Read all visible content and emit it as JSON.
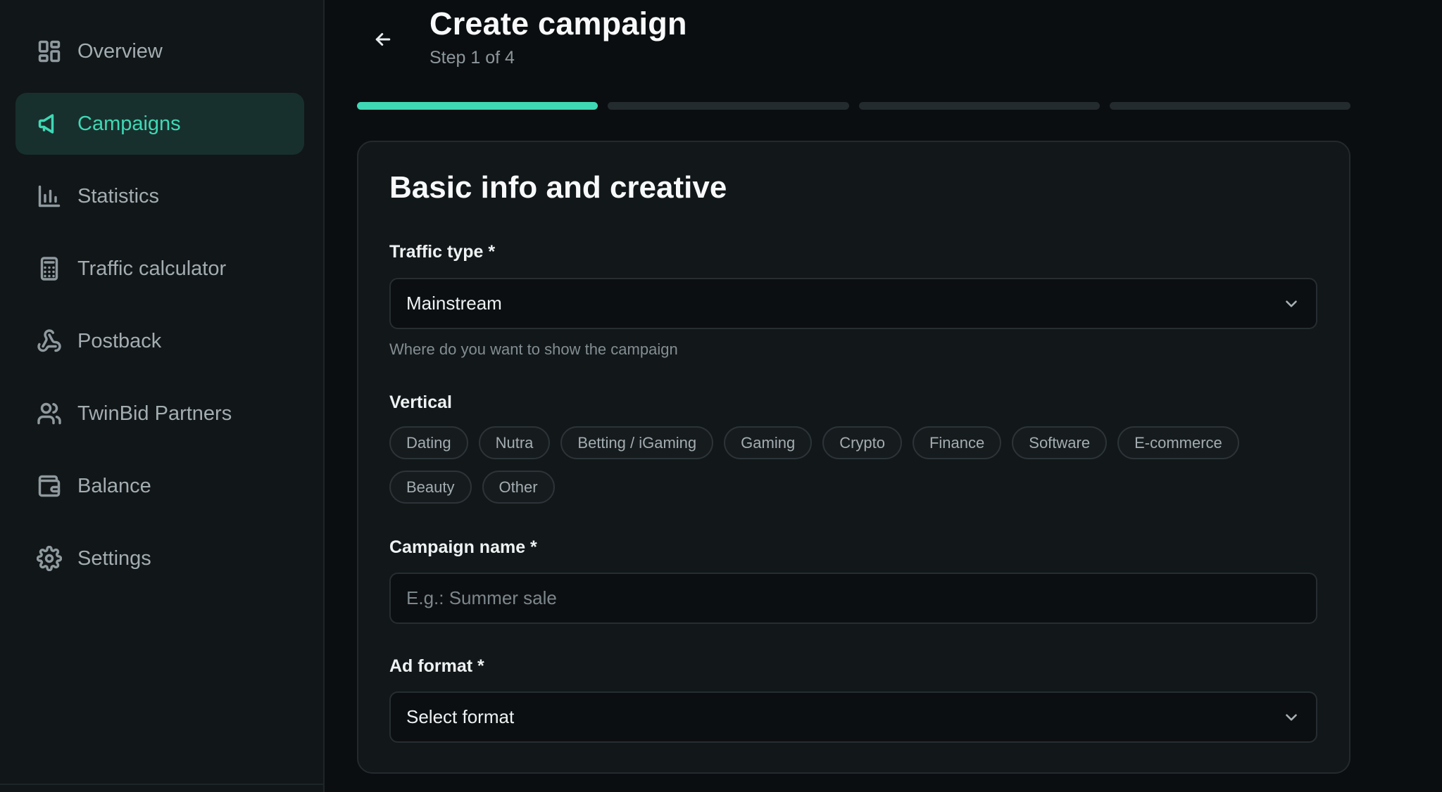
{
  "sidebar": {
    "items": [
      {
        "label": "Overview",
        "icon": "dashboard-icon",
        "active": false
      },
      {
        "label": "Campaigns",
        "icon": "megaphone-icon",
        "active": true
      },
      {
        "label": "Statistics",
        "icon": "bar-chart-icon",
        "active": false
      },
      {
        "label": "Traffic calculator",
        "icon": "calculator-icon",
        "active": false
      },
      {
        "label": "Postback",
        "icon": "webhook-icon",
        "active": false
      },
      {
        "label": "TwinBid Partners",
        "icon": "users-icon",
        "active": false
      },
      {
        "label": "Balance",
        "icon": "wallet-icon",
        "active": false
      },
      {
        "label": "Settings",
        "icon": "gear-icon",
        "active": false
      }
    ]
  },
  "header": {
    "title": "Create campaign",
    "step": "Step 1 of 4",
    "back_icon": "arrow-left-icon"
  },
  "progress": {
    "current_step": 1,
    "total_steps": 4
  },
  "form": {
    "section_title": "Basic info and creative",
    "traffic_type": {
      "label": "Traffic type *",
      "value": "Mainstream",
      "help": "Where do you want to show the campaign"
    },
    "vertical": {
      "label": "Vertical",
      "options": [
        "Dating",
        "Nutra",
        "Betting / iGaming",
        "Gaming",
        "Crypto",
        "Finance",
        "Software",
        "E-commerce",
        "Beauty",
        "Other"
      ]
    },
    "campaign_name": {
      "label": "Campaign name *",
      "placeholder": "E.g.: Summer sale",
      "value": ""
    },
    "ad_format": {
      "label": "Ad format *",
      "value": "Select format"
    }
  },
  "colors": {
    "accent": "#3ed8b5",
    "background": "#0b0e10",
    "sidebar": "#111618",
    "card": "#121719",
    "active_nav_bg": "#18302d"
  }
}
